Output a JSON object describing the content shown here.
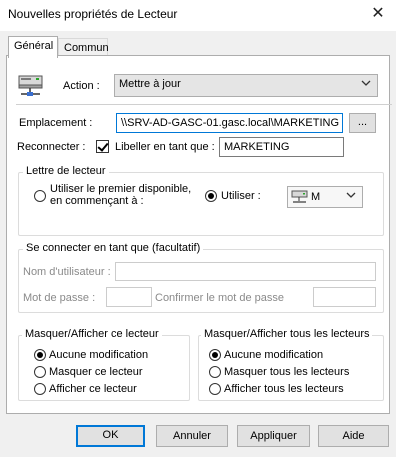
{
  "window": {
    "title": "Nouvelles propriétés de Lecteur",
    "close_glyph": "✕"
  },
  "tabs": [
    {
      "label": "Général",
      "active": true
    },
    {
      "label": "Commun",
      "active": false
    }
  ],
  "action": {
    "label": "Action :",
    "value": "Mettre à jour"
  },
  "location": {
    "label": "Emplacement :",
    "value": "\\\\SRV-AD-GASC-01.gasc.local\\MARKETING",
    "browse_label": "..."
  },
  "reconnect": {
    "label": "Reconnecter :",
    "checked": true
  },
  "caption": {
    "label": "Libeller en tant que :",
    "value": "MARKETING"
  },
  "drive_letter": {
    "title": "Lettre de lecteur",
    "first_available_line1": "Utiliser le premier disponible,",
    "first_available_line2": "en commençant à :",
    "use_label": "Utiliser :",
    "letter": "M",
    "selected": "use"
  },
  "connect_as": {
    "title": "Se connecter en tant que (facultatif)",
    "username_label": "Nom d'utilisateur :",
    "password_label": "Mot de passe :",
    "confirm_label": "Confirmer le mot de passe"
  },
  "hide_show_drive": {
    "title": "Masquer/Afficher ce lecteur",
    "options": [
      "Aucune modification",
      "Masquer ce lecteur",
      "Afficher ce lecteur"
    ],
    "selected": 0
  },
  "hide_show_all": {
    "title": "Masquer/Afficher tous les lecteurs",
    "options": [
      "Aucune modification",
      "Masquer tous les lecteurs",
      "Afficher tous les lecteurs"
    ],
    "selected": 0
  },
  "buttons": {
    "ok": "OK",
    "cancel": "Annuler",
    "apply": "Appliquer",
    "help": "Aide"
  },
  "colors": {
    "accent": "#0078d7",
    "panel_bg": "#ffffff",
    "dialog_bg": "#f0f0f0"
  }
}
